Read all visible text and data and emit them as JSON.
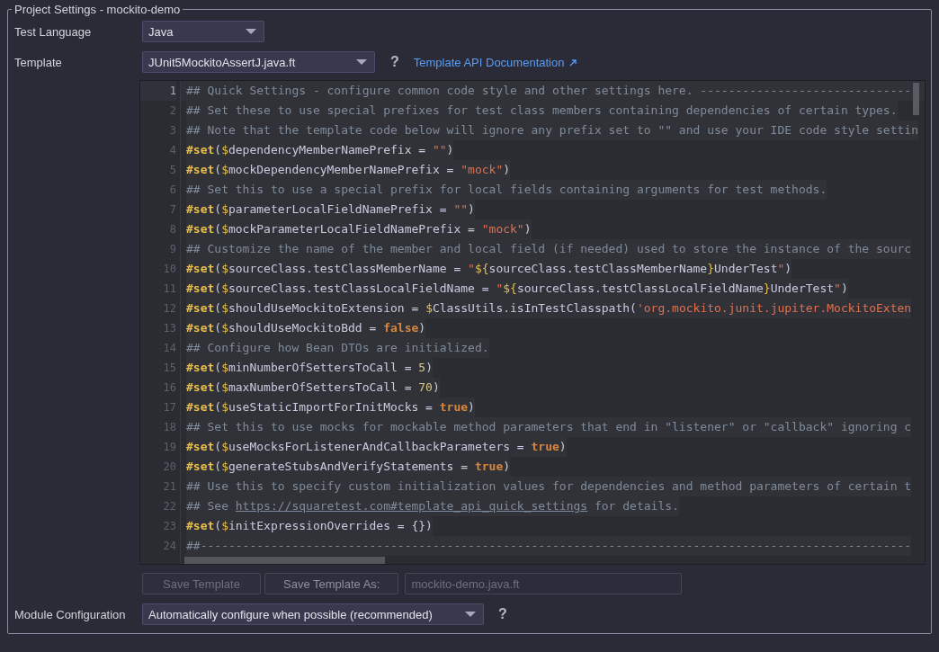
{
  "panel": {
    "title": "Project Settings - mockito-demo"
  },
  "test_language": {
    "label": "Test Language",
    "value": "Java"
  },
  "template": {
    "label": "Template",
    "value": "JUnit5MockitoAssertJ.java.ft",
    "help": "?",
    "link": "Template API Documentation"
  },
  "editor": {
    "lines": [
      {
        "number": "1",
        "current": true,
        "tokens": [
          {
            "kind": "comment",
            "text": "## Quick Settings - configure common code style and other settings here. ------------------------------"
          }
        ]
      },
      {
        "number": "2",
        "current": false,
        "tokens": [
          {
            "kind": "comment",
            "text": "## Set these to use special prefixes for test class members containing dependencies of certain types."
          }
        ]
      },
      {
        "number": "3",
        "current": false,
        "tokens": [
          {
            "kind": "comment",
            "text": "## Note that the template code below will ignore any prefix set to \"\" and use your IDE code style settin"
          }
        ]
      },
      {
        "number": "4",
        "current": false,
        "tokens": [
          {
            "kind": "keyword",
            "text": "#set"
          },
          {
            "kind": "plain",
            "text": "("
          },
          {
            "kind": "dollar",
            "text": "$"
          },
          {
            "kind": "var",
            "text": "dependencyMemberNamePrefix = "
          },
          {
            "kind": "string",
            "text": "\"\""
          },
          {
            "kind": "plain",
            "text": ")"
          }
        ]
      },
      {
        "number": "5",
        "current": false,
        "tokens": [
          {
            "kind": "keyword",
            "text": "#set"
          },
          {
            "kind": "plain",
            "text": "("
          },
          {
            "kind": "dollar",
            "text": "$"
          },
          {
            "kind": "var",
            "text": "mockDependencyMemberNamePrefix = "
          },
          {
            "kind": "string",
            "text": "\"mock\""
          },
          {
            "kind": "plain",
            "text": ")"
          }
        ]
      },
      {
        "number": "6",
        "current": false,
        "tokens": [
          {
            "kind": "comment",
            "text": "## Set this to use a special prefix for local fields containing arguments for test methods."
          }
        ]
      },
      {
        "number": "7",
        "current": false,
        "tokens": [
          {
            "kind": "keyword",
            "text": "#set"
          },
          {
            "kind": "plain",
            "text": "("
          },
          {
            "kind": "dollar",
            "text": "$"
          },
          {
            "kind": "var",
            "text": "parameterLocalFieldNamePrefix = "
          },
          {
            "kind": "string",
            "text": "\"\""
          },
          {
            "kind": "plain",
            "text": ")"
          }
        ]
      },
      {
        "number": "8",
        "current": false,
        "tokens": [
          {
            "kind": "keyword",
            "text": "#set"
          },
          {
            "kind": "plain",
            "text": "("
          },
          {
            "kind": "dollar",
            "text": "$"
          },
          {
            "kind": "var",
            "text": "mockParameterLocalFieldNamePrefix = "
          },
          {
            "kind": "string",
            "text": "\"mock\""
          },
          {
            "kind": "plain",
            "text": ")"
          }
        ]
      },
      {
        "number": "9",
        "current": false,
        "tokens": [
          {
            "kind": "comment",
            "text": "## Customize the name of the member and local field (if needed) used to store the instance of the sourc"
          }
        ]
      },
      {
        "number": "10",
        "current": false,
        "tokens": [
          {
            "kind": "keyword",
            "text": "#set"
          },
          {
            "kind": "plain",
            "text": "("
          },
          {
            "kind": "dollar",
            "text": "$"
          },
          {
            "kind": "var",
            "text": "sourceClass.testClassMemberName = "
          },
          {
            "kind": "string",
            "text": "\""
          },
          {
            "kind": "dollar",
            "text": "${"
          },
          {
            "kind": "var",
            "text": "sourceClass.testClassMemberName"
          },
          {
            "kind": "dollar",
            "text": "}"
          },
          {
            "kind": "var",
            "text": "UnderTest"
          },
          {
            "kind": "string",
            "text": "\""
          },
          {
            "kind": "plain",
            "text": ")"
          }
        ]
      },
      {
        "number": "11",
        "current": false,
        "tokens": [
          {
            "kind": "keyword",
            "text": "#set"
          },
          {
            "kind": "plain",
            "text": "("
          },
          {
            "kind": "dollar",
            "text": "$"
          },
          {
            "kind": "var",
            "text": "sourceClass.testClassLocalFieldName = "
          },
          {
            "kind": "string",
            "text": "\""
          },
          {
            "kind": "dollar",
            "text": "${"
          },
          {
            "kind": "var",
            "text": "sourceClass.testClassLocalFieldName"
          },
          {
            "kind": "dollar",
            "text": "}"
          },
          {
            "kind": "var",
            "text": "UnderTest"
          },
          {
            "kind": "string",
            "text": "\""
          },
          {
            "kind": "plain",
            "text": ")"
          }
        ]
      },
      {
        "number": "12",
        "current": false,
        "tokens": [
          {
            "kind": "keyword",
            "text": "#set"
          },
          {
            "kind": "plain",
            "text": "("
          },
          {
            "kind": "dollar",
            "text": "$"
          },
          {
            "kind": "var",
            "text": "shouldUseMockitoExtension = "
          },
          {
            "kind": "dollar",
            "text": "$"
          },
          {
            "kind": "var",
            "text": "ClassUtils.isInTestClasspath("
          },
          {
            "kind": "string",
            "text": "'org.mockito.junit.jupiter.MockitoExten"
          }
        ]
      },
      {
        "number": "13",
        "current": false,
        "tokens": [
          {
            "kind": "keyword",
            "text": "#set"
          },
          {
            "kind": "plain",
            "text": "("
          },
          {
            "kind": "dollar",
            "text": "$"
          },
          {
            "kind": "var",
            "text": "shouldUseMockitoBdd = "
          },
          {
            "kind": "bool",
            "text": "false"
          },
          {
            "kind": "plain",
            "text": ")"
          }
        ]
      },
      {
        "number": "14",
        "current": false,
        "tokens": [
          {
            "kind": "comment",
            "text": "## Configure how Bean DTOs are initialized."
          }
        ]
      },
      {
        "number": "15",
        "current": false,
        "tokens": [
          {
            "kind": "keyword",
            "text": "#set"
          },
          {
            "kind": "plain",
            "text": "("
          },
          {
            "kind": "dollar",
            "text": "$"
          },
          {
            "kind": "var",
            "text": "minNumberOfSettersToCall = "
          },
          {
            "kind": "number",
            "text": "5"
          },
          {
            "kind": "plain",
            "text": ")"
          }
        ]
      },
      {
        "number": "16",
        "current": false,
        "tokens": [
          {
            "kind": "keyword",
            "text": "#set"
          },
          {
            "kind": "plain",
            "text": "("
          },
          {
            "kind": "dollar",
            "text": "$"
          },
          {
            "kind": "var",
            "text": "maxNumberOfSettersToCall = "
          },
          {
            "kind": "number",
            "text": "70"
          },
          {
            "kind": "plain",
            "text": ")"
          }
        ]
      },
      {
        "number": "17",
        "current": false,
        "tokens": [
          {
            "kind": "keyword",
            "text": "#set"
          },
          {
            "kind": "plain",
            "text": "("
          },
          {
            "kind": "dollar",
            "text": "$"
          },
          {
            "kind": "var",
            "text": "useStaticImportForInitMocks = "
          },
          {
            "kind": "bool",
            "text": "true"
          },
          {
            "kind": "plain",
            "text": ")"
          }
        ]
      },
      {
        "number": "18",
        "current": false,
        "tokens": [
          {
            "kind": "comment",
            "text": "## Set this to use mocks for mockable method parameters that end in \"listener\" or \"callback\" ignoring c"
          }
        ]
      },
      {
        "number": "19",
        "current": false,
        "tokens": [
          {
            "kind": "keyword",
            "text": "#set"
          },
          {
            "kind": "plain",
            "text": "("
          },
          {
            "kind": "dollar",
            "text": "$"
          },
          {
            "kind": "var",
            "text": "useMocksForListenerAndCallbackParameters = "
          },
          {
            "kind": "bool",
            "text": "true"
          },
          {
            "kind": "plain",
            "text": ")"
          }
        ]
      },
      {
        "number": "20",
        "current": false,
        "tokens": [
          {
            "kind": "keyword",
            "text": "#set"
          },
          {
            "kind": "plain",
            "text": "("
          },
          {
            "kind": "dollar",
            "text": "$"
          },
          {
            "kind": "var",
            "text": "generateStubsAndVerifyStatements = "
          },
          {
            "kind": "bool",
            "text": "true"
          },
          {
            "kind": "plain",
            "text": ")"
          }
        ]
      },
      {
        "number": "21",
        "current": false,
        "tokens": [
          {
            "kind": "comment",
            "text": "## Use this to specify custom initialization values for dependencies and method parameters of certain t"
          }
        ]
      },
      {
        "number": "22",
        "current": false,
        "tokens": [
          {
            "kind": "comment",
            "text": "## See "
          },
          {
            "kind": "link",
            "text": "https://squaretest.com#template_api_quick_settings"
          },
          {
            "kind": "comment",
            "text": " for details."
          }
        ]
      },
      {
        "number": "23",
        "current": false,
        "tokens": [
          {
            "kind": "keyword",
            "text": "#set"
          },
          {
            "kind": "plain",
            "text": "("
          },
          {
            "kind": "dollar",
            "text": "$"
          },
          {
            "kind": "var",
            "text": "initExpressionOverrides = {})"
          }
        ]
      },
      {
        "number": "24",
        "current": false,
        "tokens": [
          {
            "kind": "comment",
            "text": "##-----------------------------------------------------------------------------------------------------"
          }
        ]
      }
    ]
  },
  "save_buttons": [
    {
      "label": "Save Template",
      "disabled": true
    },
    {
      "label": "Save Template As:",
      "disabled": false
    }
  ],
  "file_name_field": {
    "value": "mockito-demo.java.ft",
    "disabled": true
  },
  "module_configuration": {
    "label": "Module Configuration",
    "value": "Automatically configure when possible (recommended)",
    "help": "?"
  }
}
